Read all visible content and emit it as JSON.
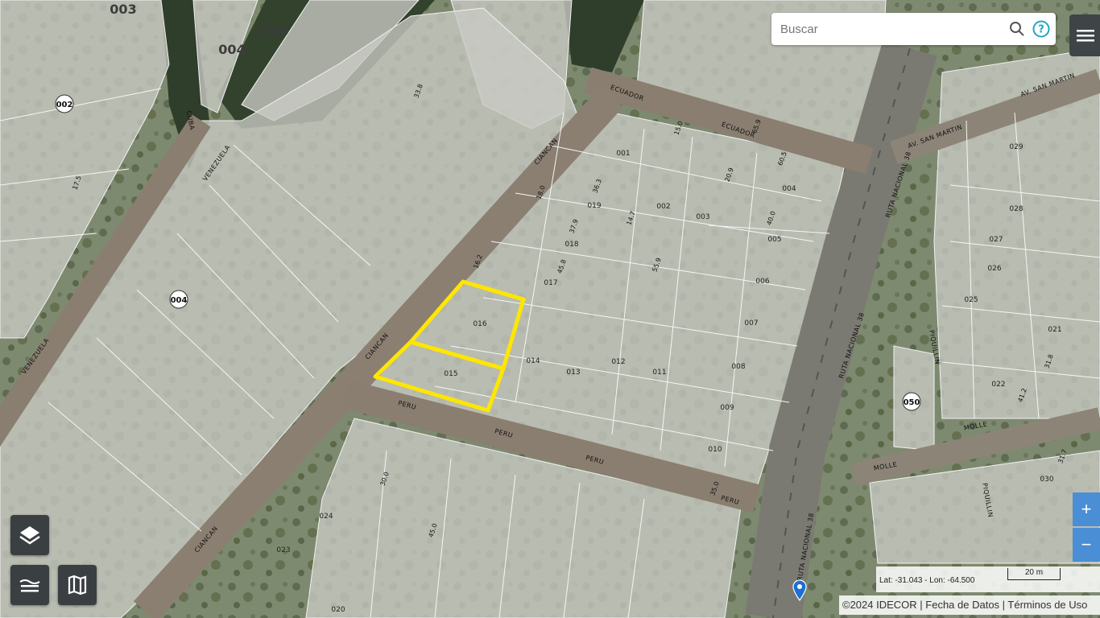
{
  "search": {
    "placeholder": "Buscar"
  },
  "icons": {
    "search": "search-icon",
    "help": "help-icon",
    "menu": "menu-icon",
    "layers": "layers-icon",
    "basemap": "basemap-icon",
    "map": "map-icon",
    "marker": "location-marker-icon"
  },
  "colors": {
    "parcel_highlight": "#ffe600",
    "zoom_button": "#4a8ed6",
    "control_bg": "#3a3f42"
  },
  "zoom": {
    "in_label": "+",
    "out_label": "−"
  },
  "coords": {
    "text": "Lat: -31.043 - Lon: -64.500",
    "scale": "20 m"
  },
  "attribution": "©2024 IDECOR | Fecha de Datos | Términos de Uso",
  "streets": [
    "ECUADOR",
    "ECUADOR",
    "CIANCAN",
    "CIANCAN",
    "CIANCAN",
    "PERU",
    "PERU",
    "PERU",
    "PERU",
    "VENEZUELA",
    "VENEZUELA",
    "CUBA",
    "AV. SAN MARTIN",
    "AV. SAN MARTIN",
    "RUTA NACIONAL 38",
    "RUTA NACIONAL 38",
    "RUTA NACIONAL 38",
    "MOLLE",
    "MOLLE",
    "PIQUILLIN",
    "PIQUILLIN"
  ],
  "blocks": [
    "002",
    "004",
    "050",
    "003",
    "003",
    "004"
  ],
  "parcels": [
    "001",
    "002",
    "003",
    "004",
    "005",
    "006",
    "007",
    "008",
    "009",
    "010",
    "011",
    "012",
    "013",
    "014",
    "015",
    "016",
    "017",
    "018",
    "019",
    "020",
    "021",
    "022",
    "023",
    "024",
    "025",
    "026",
    "027",
    "028",
    "029",
    "030"
  ],
  "dimensions": [
    "15.0",
    "40.0",
    "35.0",
    "45.0",
    "30.0",
    "37.9",
    "36.3",
    "45.8",
    "55.9",
    "14.7",
    "33.8",
    "20.9",
    "60.5",
    "65.9",
    "16.2",
    "17.5",
    "18.0",
    "41.2",
    "31.8",
    "31.7"
  ]
}
